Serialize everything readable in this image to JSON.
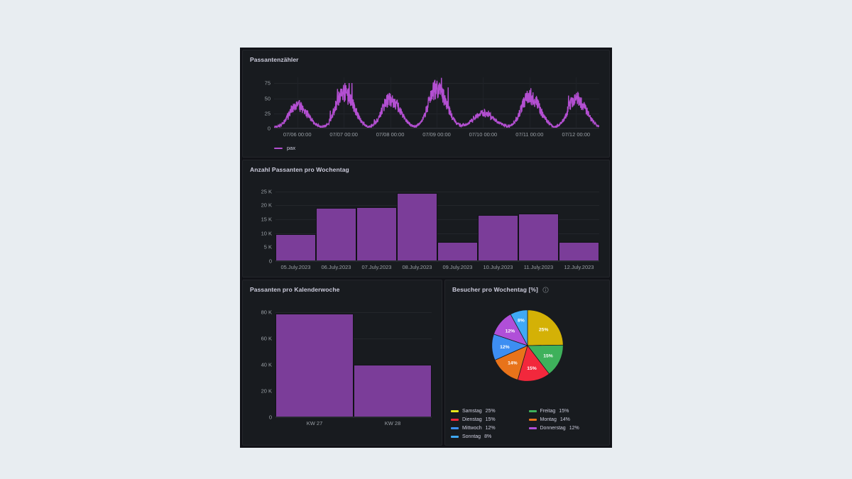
{
  "theme": {
    "page_background": "#e8edf1",
    "dashboard_background": "#111217",
    "panel_background": "#181b1f",
    "accent_purple": "#7b3d99",
    "text_primary": "#ccccdc",
    "text_muted": "#9aa0a6"
  },
  "panels": {
    "timeseries": {
      "title": "Passantenzähler",
      "legend": [
        {
          "label": "pax",
          "color": "#b34fd1",
          "icon": "line-dash"
        }
      ]
    },
    "weekday_bars": {
      "title": "Anzahl Passanten pro Wochentag"
    },
    "calendarweek_bars": {
      "title": "Passanten pro Kalenderwoche"
    },
    "pie": {
      "title": "Besucher pro Wochentag [%]",
      "info_icon": "info-circle-icon"
    }
  },
  "chart_data": [
    {
      "type": "line",
      "panel": "Passantenzähler",
      "title": "Passantenzähler",
      "xlabel": "",
      "ylabel": "",
      "ylim": [
        0,
        85
      ],
      "yticks": [
        "0",
        "25",
        "50",
        "75"
      ],
      "ytick_values": [
        0,
        25,
        50,
        75
      ],
      "xticks": [
        "07/06 00:00",
        "07/07 00:00",
        "07/08 00:00",
        "07/09 00:00",
        "07/10 00:00",
        "07/11 00:00",
        "07/12 00:00"
      ],
      "grid": true,
      "legend_position": "bottom-left",
      "series": [
        {
          "name": "pax",
          "color": "#b34fd1",
          "description": "Noisy daily passenger counts, 7 daily peaks",
          "daily_peaks": [
            45,
            70,
            57,
            78,
            30,
            62,
            58
          ],
          "daily_troughs": [
            2,
            2,
            2,
            3,
            5,
            3,
            2
          ]
        }
      ]
    },
    {
      "type": "bar",
      "panel": "Anzahl Passanten pro Wochentag",
      "title": "Anzahl Passanten pro Wochentag",
      "xlabel": "",
      "ylabel": "",
      "categories": [
        "05.July.2023",
        "06.July.2023",
        "07.July.2023",
        "08.July.2023",
        "09.July.2023",
        "10.July.2023",
        "11.July.2023",
        "12.July.2023"
      ],
      "values": [
        9700,
        19000,
        19300,
        24500,
        7000,
        16600,
        17000,
        7000
      ],
      "ylim": [
        0,
        27000
      ],
      "yticks": [
        "0",
        "5 K",
        "10 K",
        "15 K",
        "20 K",
        "25 K"
      ],
      "ytick_values": [
        0,
        5000,
        10000,
        15000,
        20000,
        25000
      ],
      "grid": true,
      "color": "#7b3d99"
    },
    {
      "type": "bar",
      "panel": "Passanten pro Kalenderwoche",
      "title": "Passanten pro Kalenderwoche",
      "xlabel": "",
      "ylabel": "",
      "categories": [
        "KW 27",
        "KW 28"
      ],
      "values": [
        79000,
        40000
      ],
      "ylim": [
        0,
        85000
      ],
      "yticks": [
        "0",
        "20 K",
        "40 K",
        "60 K",
        "80 K"
      ],
      "ytick_values": [
        0,
        20000,
        40000,
        60000,
        80000
      ],
      "grid": true,
      "color": "#7b3d99"
    },
    {
      "type": "pie",
      "panel": "Besucher pro Wochentag [%]",
      "title": "Besucher pro Wochentag [%]",
      "unit": "%",
      "start_angle_deg": 0,
      "direction": "clockwise",
      "slices": [
        {
          "label": "Samstag",
          "value": 25,
          "display": "25%",
          "legend_value": "25%",
          "color": "#d4b106"
        },
        {
          "label": "Freitag",
          "value": 15,
          "display": "15%",
          "legend_value": "15%",
          "color": "#3eb15b"
        },
        {
          "label": "Dienstag",
          "value": 15,
          "display": "15%",
          "legend_value": "15%",
          "color": "#f2283c"
        },
        {
          "label": "Montag",
          "value": 14,
          "display": "14%",
          "legend_value": "14%",
          "color": "#e8731a"
        },
        {
          "label": "Mittwoch",
          "value": 12,
          "display": "12%",
          "legend_value": "12%",
          "color": "#3d8ef2"
        },
        {
          "label": "Donnerstag",
          "value": 12,
          "display": "12%",
          "legend_value": "12%",
          "color": "#b04fd8"
        },
        {
          "label": "Sonntag",
          "value": 8,
          "display": "8%",
          "legend_value": "8%",
          "color": "#3fa9f5"
        }
      ],
      "legend_order": [
        {
          "label": "Samstag",
          "value": "25%",
          "color": "#e8e81a"
        },
        {
          "label": "Freitag",
          "value": "15%",
          "color": "#3eb15b"
        },
        {
          "label": "Dienstag",
          "value": "15%",
          "color": "#f2283c"
        },
        {
          "label": "Montag",
          "value": "14%",
          "color": "#e8731a"
        },
        {
          "label": "Mittwoch",
          "value": "12%",
          "color": "#3d8ef2"
        },
        {
          "label": "Donnerstag",
          "value": "12%",
          "color": "#b04fd8"
        },
        {
          "label": "Sonntag",
          "value": "8%",
          "color": "#3fa9f5"
        }
      ]
    }
  ]
}
